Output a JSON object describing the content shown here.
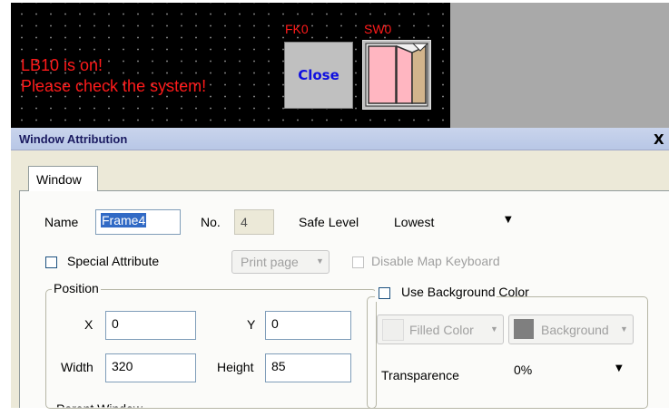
{
  "canvas": {
    "line1": "LB10 is on!",
    "line2": "Please check the system!",
    "fk0_label": "FK0",
    "fk0_button_text": "Close",
    "sw0_label": "SW0"
  },
  "dialog": {
    "title": "Window Attribution",
    "close_glyph": "X",
    "tab_label": "Window",
    "name_label": "Name",
    "name_value": "Frame4",
    "no_label": "No.",
    "no_value": "4",
    "safe_level_label": "Safe Level",
    "safe_level_value": "Lowest",
    "special_attr_label": "Special Attribute",
    "print_page_label": "Print page",
    "disable_map_keyboard_label": "Disable Map Keyboard",
    "position_label": "Position",
    "x_label": "X",
    "x_value": "0",
    "y_label": "Y",
    "y_value": "0",
    "width_label": "Width",
    "width_value": "320",
    "height_label": "Height",
    "height_value": "85",
    "use_bg_color_label": "Use Background Color",
    "filled_color_label": "Filled Color",
    "background_label": "Background",
    "transparence_label": "Transparence",
    "transparence_value": "0%",
    "partial_text": "Parent Window"
  },
  "colors": {
    "canvas_bg": "#000000",
    "canvas_text": "#ff1a1a",
    "close_text": "#1010e0",
    "dialog_bg": "#ece9d8",
    "switch_fill": "#ffb6c1",
    "switch_door": "#d2b48c"
  }
}
